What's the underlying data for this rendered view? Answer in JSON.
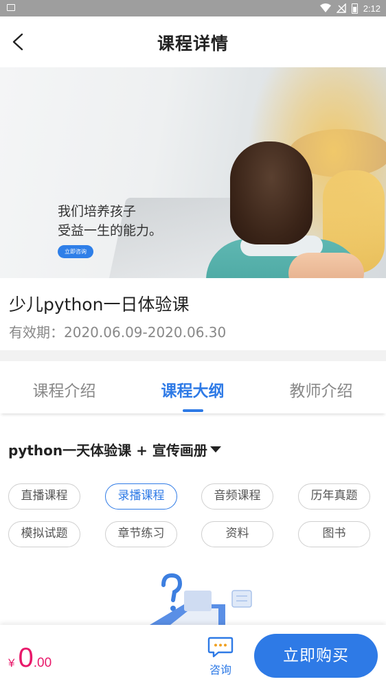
{
  "status_bar": {
    "time": "2:12"
  },
  "header": {
    "title": "课程详情"
  },
  "banner": {
    "line1": "我们培养孩子",
    "line2": "受益一生的能力。",
    "button_label": "立即咨询"
  },
  "course": {
    "title": "少儿python一日体验课",
    "validity_label": "有效期：",
    "validity_range": "2020.06.09-2020.06.30"
  },
  "tabs": [
    {
      "label": "课程介绍",
      "active": false
    },
    {
      "label": "课程大纲",
      "active": true
    },
    {
      "label": "教师介绍",
      "active": false
    }
  ],
  "outline": {
    "heading": "python一天体验课 + 宣传画册",
    "chips": [
      {
        "label": "直播课程",
        "active": false
      },
      {
        "label": "录播课程",
        "active": true
      },
      {
        "label": "音频课程",
        "active": false
      },
      {
        "label": "历年真题",
        "active": false
      },
      {
        "label": "模拟试题",
        "active": false
      },
      {
        "label": "章节练习",
        "active": false
      },
      {
        "label": "资料",
        "active": false
      },
      {
        "label": "图书",
        "active": false
      }
    ]
  },
  "bottom_bar": {
    "currency": "¥",
    "price_int": "0",
    "price_dec": ".00",
    "consult_label": "咨询",
    "buy_label": "立即购买"
  },
  "colors": {
    "accent": "#2e7ae6",
    "price": "#e8196a",
    "muted": "#888888"
  }
}
